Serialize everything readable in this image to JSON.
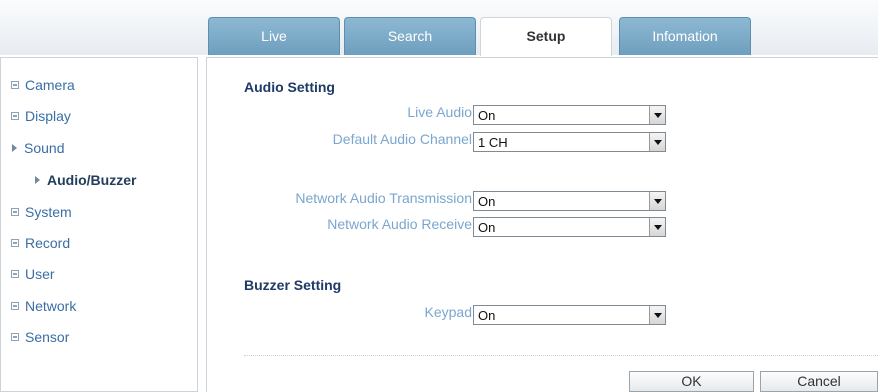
{
  "tabs": [
    {
      "label": "Live",
      "active": false
    },
    {
      "label": "Search",
      "active": false
    },
    {
      "label": "Setup",
      "active": true
    },
    {
      "label": "Infomation",
      "active": false
    }
  ],
  "sidebar": {
    "items": [
      {
        "label": "Camera",
        "icon": "expand-icon"
      },
      {
        "label": "Display",
        "icon": "expand-icon"
      },
      {
        "label": "Sound",
        "icon": "collapse-arrow-icon",
        "expanded": true
      },
      {
        "label": "Audio/Buzzer",
        "icon": "arrow-icon",
        "selected": true
      },
      {
        "label": "System",
        "icon": "expand-icon"
      },
      {
        "label": "Record",
        "icon": "expand-icon"
      },
      {
        "label": "User",
        "icon": "expand-icon"
      },
      {
        "label": "Network",
        "icon": "expand-icon"
      },
      {
        "label": "Sensor",
        "icon": "expand-icon"
      }
    ]
  },
  "audio_setting": {
    "title": "Audio Setting",
    "live_audio": {
      "label": "Live Audio",
      "value": "On"
    },
    "default_channel": {
      "label": "Default Audio Channel",
      "value": "1 CH"
    },
    "net_transmission": {
      "label": "Network Audio Transmission",
      "value": "On"
    },
    "net_receive": {
      "label": "Network Audio Receive",
      "value": "On"
    }
  },
  "buzzer_setting": {
    "title": "Buzzer Setting",
    "keypad": {
      "label": "Keypad",
      "value": "On"
    }
  },
  "actions": {
    "ok": "OK",
    "cancel": "Cancel"
  },
  "colors": {
    "tab_blue": "#7eabc9",
    "menu_link": "#3a6ea5",
    "section_title": "#1f3a66",
    "field_label": "#7aa6cf"
  }
}
